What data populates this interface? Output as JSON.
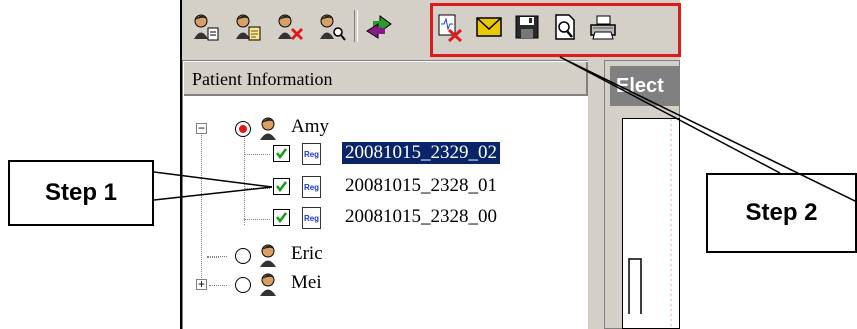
{
  "pane": {
    "header": "Patient Information"
  },
  "right_pane": {
    "title": "Elect"
  },
  "toolbar": {
    "icons": [
      "add-patient-icon",
      "edit-patient-icon",
      "delete-patient-icon",
      "search-patient-icon",
      "transfer-icon",
      "delete-record-icon",
      "mail-icon",
      "save-icon",
      "print-preview-icon",
      "print-icon"
    ]
  },
  "tree": {
    "patients": [
      {
        "name": "Amy",
        "expanded": true,
        "selected": true,
        "records": [
          {
            "id": "20081015_2329_02",
            "checked": true,
            "selected": true
          },
          {
            "id": "20081015_2328_01",
            "checked": true,
            "selected": false
          },
          {
            "id": "20081015_2328_00",
            "checked": true,
            "selected": false
          }
        ]
      },
      {
        "name": "Eric",
        "expanded": false,
        "selected": false
      },
      {
        "name": "Mei",
        "expanded": false,
        "selected": false
      }
    ]
  },
  "record_icon_label": "Reg",
  "callouts": {
    "step1": "Step 1",
    "step2": "Step 2"
  },
  "colors": {
    "highlight": "#e01a1a",
    "selection": "#0a246a",
    "check": "#1a9a1a"
  }
}
